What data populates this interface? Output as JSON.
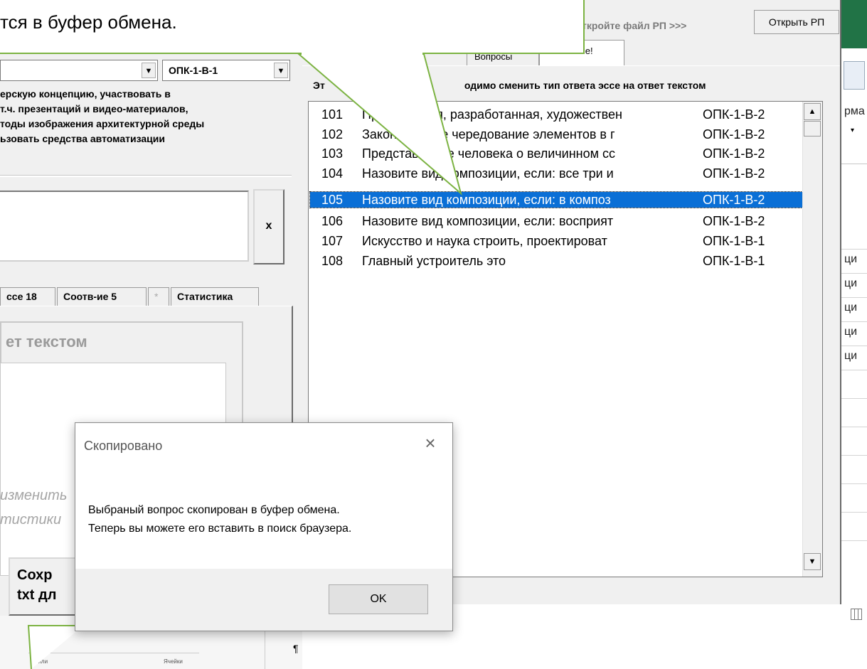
{
  "callout": {
    "text": "тся в буфер обмена."
  },
  "header": {
    "open_hint": "ткройте файл РП >>>",
    "open_button": "Открыть РП"
  },
  "left": {
    "competency_combo": "ОПК-1-В-1",
    "description_lines": [
      "ерскую концепцию, участвовать в",
      "т.ч. презентаций и видео-материалов,",
      "тоды изображения архитектурной среды",
      "ьзовать средства автоматизации"
    ],
    "clear_button": "x",
    "tabs": [
      "ссе 18",
      "Соотв-ие 5",
      "*",
      "Статистика"
    ],
    "essay_title": "ет текстом",
    "ghost_lines": [
      "изменить",
      "тистики"
    ],
    "save_button_lines": [
      "Сохр",
      "txt дл"
    ],
    "tiny_styles": "Стили",
    "tiny_cells": "Ячейки",
    "pilcrow": "¶"
  },
  "right": {
    "tabs": [
      "Вопросы",
      "Внимание!"
    ],
    "warning_start": "Эт",
    "warning_end": "одимо сменить тип ответа эссе на ответ текстом",
    "questions": [
      {
        "num": "101",
        "text": "Продуманная, разработанная, художествен",
        "code": "ОПК-1-В-2"
      },
      {
        "num": "102",
        "text": "Закономерное чередование элементов в г",
        "code": "ОПК-1-В-2"
      },
      {
        "num": "103",
        "text": "Представление человека о величинном сс",
        "code": "ОПК-1-В-2"
      },
      {
        "num": "104",
        "text": "Назовите вид композиции, если: все три и",
        "code": "ОПК-1-В-2"
      },
      {
        "num": "105",
        "text": "Назовите вид композиции, если: в композ",
        "code": "ОПК-1-В-2"
      },
      {
        "num": "106",
        "text": "Назовите вид композиции, если: восприят",
        "code": "ОПК-1-В-2"
      },
      {
        "num": "107",
        "text": "Искусство и наука строить, проектироват",
        "code": "ОПК-1-В-1"
      },
      {
        "num": "108",
        "text": "Главный устроитель это",
        "code": "ОПК-1-В-1"
      }
    ]
  },
  "excel_strip": {
    "labels": [
      "рма",
      "ци",
      "ци",
      "ци",
      "ци",
      "ци"
    ]
  },
  "dialog": {
    "title": "Скопировано",
    "line1": "Выбраный вопрос скопирован в буфер обмена.",
    "line2": "Теперь вы можете его вставить в поиск браузера.",
    "ok": "OK"
  }
}
